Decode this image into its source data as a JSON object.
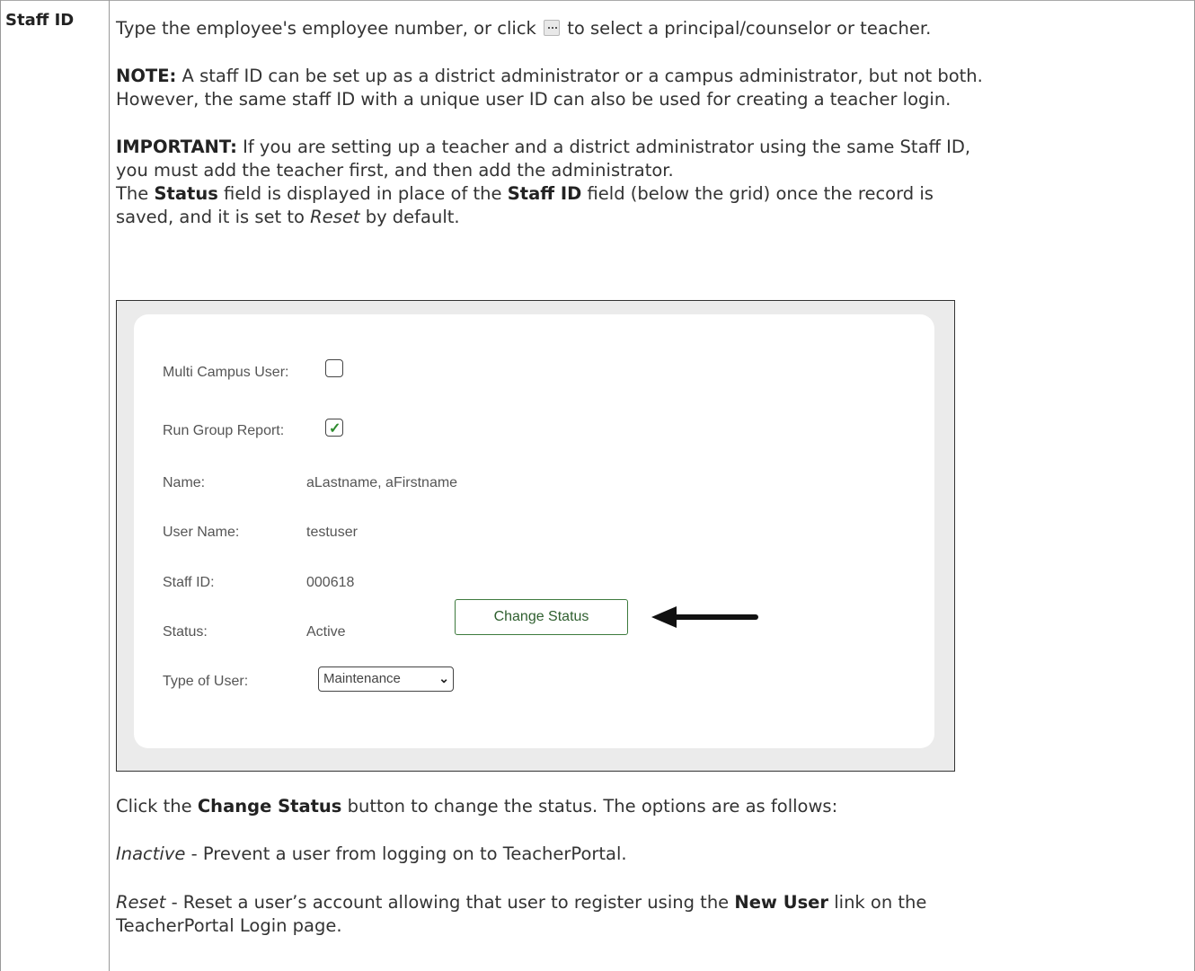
{
  "term": "Staff ID",
  "paragraphs": {
    "intro_before": "Type the employee's employee number, or click",
    "intro_after": "to select a principal/counselor or teacher.",
    "note_label": "NOTE:",
    "note_line1": "A staff ID can be set up as a district administrator or a campus administrator, but not both.",
    "note_line2": "However, the same staff ID with a unique user ID can also be used for creating a teacher login.",
    "important_label": "IMPORTANT:",
    "important_line1": "If you are setting up a teacher and a district administrator using the same Staff ID,",
    "important_line2": "you must add the teacher first, and then add the administrator.",
    "status_the": "The",
    "status_word": "Status",
    "status_mid": "field is displayed in place of the",
    "staffid_word": "Staff ID",
    "status_end": "field (below the grid) once the record is",
    "saved_pre": "saved, and it is set to",
    "saved_reset": "Reset",
    "saved_post": "by default.",
    "click_pre": "Click the",
    "click_btn": "Change Status",
    "click_post": "button to change the status. The options are as follows:",
    "inactive_term": "Inactive",
    "inactive_desc": "- Prevent a user from logging on to TeacherPortal.",
    "reset_term": "Reset",
    "reset_desc1": "- Reset a user’s account allowing that user to register using the",
    "reset_link": "New User",
    "reset_desc2": "link on the",
    "reset_line2": "TeacherPortal Login page."
  },
  "icons": {
    "select_button": "ellipsis-button-icon",
    "arrow": "left-arrow-icon"
  },
  "form": {
    "multi_campus_label": "Multi Campus User:",
    "multi_campus_checked": false,
    "run_group_label": "Run Group Report:",
    "run_group_checked": true,
    "name_label": "Name:",
    "name_value": "aLastname, aFirstname",
    "username_label": "User Name:",
    "username_value": "testuser",
    "staffid_label": "Staff ID:",
    "staffid_value": "000618",
    "status_label": "Status:",
    "status_value": "Active",
    "change_status_button": "Change Status",
    "type_label": "Type of User:",
    "type_value": "Maintenance"
  },
  "colors": {
    "button_border": "#3d7a3d",
    "check": "#2e8b2e"
  }
}
